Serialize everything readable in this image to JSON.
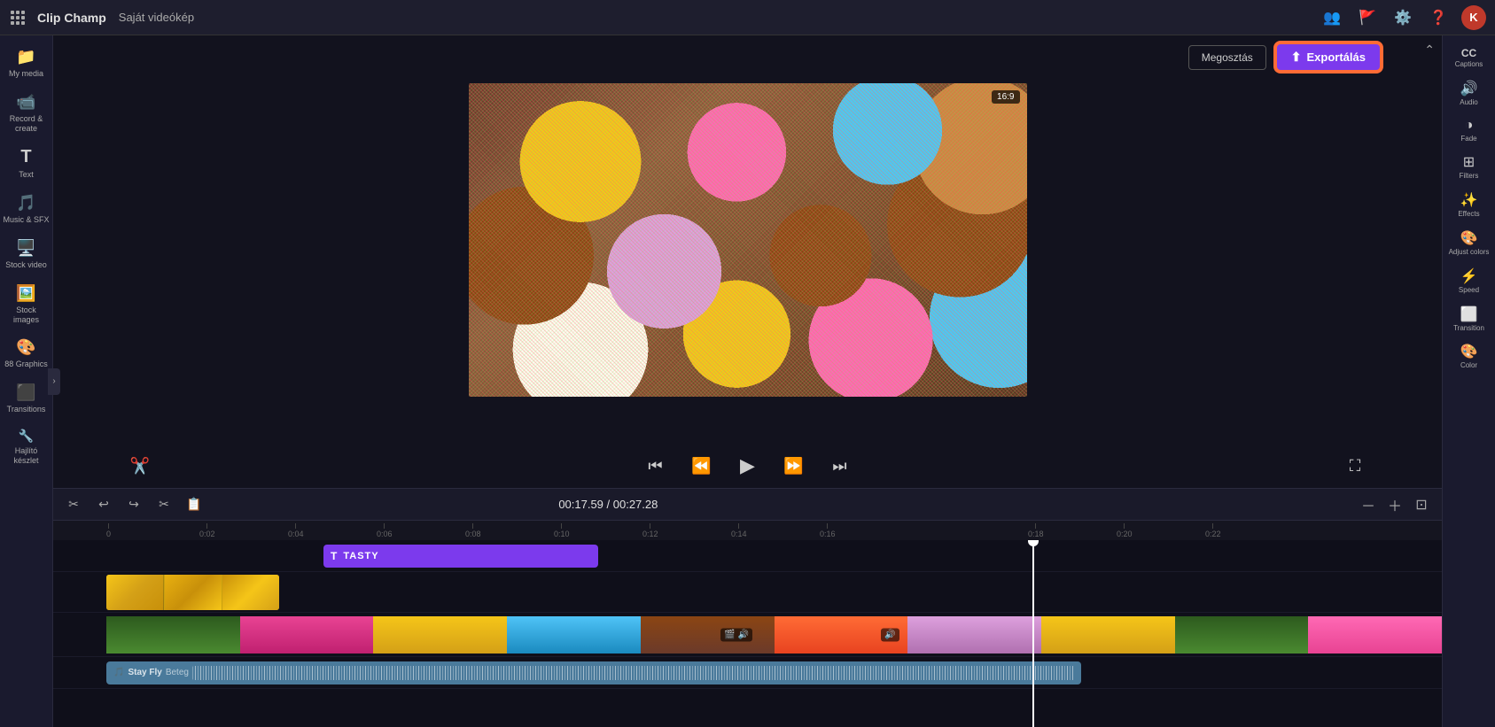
{
  "app": {
    "name": "Clip Champ",
    "project_name": "Saját videókép",
    "avatar_initial": "K"
  },
  "topbar": {
    "icons": [
      "grid",
      "people",
      "flag",
      "settings",
      "help"
    ]
  },
  "left_sidebar": {
    "items": [
      {
        "id": "my-media",
        "icon": "🎬",
        "label": "My media"
      },
      {
        "id": "record-create",
        "icon": "📹",
        "label": "Record &\ncreate"
      },
      {
        "id": "text",
        "icon": "T",
        "label": "Text"
      },
      {
        "id": "music-sfx",
        "icon": "🎵",
        "label": "Music & SFX"
      },
      {
        "id": "stock-video",
        "icon": "🖥",
        "label": "Stock video"
      },
      {
        "id": "stock-images",
        "icon": "🖼",
        "label": "Stock images"
      },
      {
        "id": "graphics",
        "icon": "🎨",
        "label": "Graphics"
      },
      {
        "id": "transitions",
        "icon": "⬛",
        "label": "Transitions"
      },
      {
        "id": "hajlito-keszlet",
        "icon": "🔧",
        "label": "Hajlító készlet"
      }
    ]
  },
  "right_sidebar": {
    "items": [
      {
        "id": "captions",
        "icon": "CC",
        "label": "Captions"
      },
      {
        "id": "audio",
        "icon": "🔊",
        "label": "Audio"
      },
      {
        "id": "fade",
        "icon": "◑",
        "label": "Fade"
      },
      {
        "id": "filters",
        "icon": "🔳",
        "label": "Filters"
      },
      {
        "id": "effects",
        "icon": "✨",
        "label": "Effects"
      },
      {
        "id": "adjust-colors",
        "icon": "🎨",
        "label": "Adjust colors"
      },
      {
        "id": "speed",
        "icon": "⚡",
        "label": "Speed"
      },
      {
        "id": "transition",
        "icon": "⬜",
        "label": "Transition"
      },
      {
        "id": "color",
        "icon": "🎨",
        "label": "Color"
      }
    ]
  },
  "header_actions": {
    "share_label": "Megosztás",
    "export_label": "Exportálás",
    "aspect_ratio": "16:9"
  },
  "player": {
    "current_time": "00:17.59",
    "total_time": "00:27.28"
  },
  "timeline": {
    "time_display": "00:17.59 / 00:27.28",
    "playhead_position_pct": 68,
    "ruler_marks": [
      "0",
      "0:02",
      "0:04",
      "0:06",
      "0:08",
      "0:10",
      "0:12",
      "0:14",
      "0:16",
      "0:18",
      "0:20",
      "0:22"
    ],
    "tracks": {
      "title_clip_label": "TASTY",
      "audio_track_name": "Stay Fly",
      "audio_track_artist": "Beteg"
    }
  }
}
